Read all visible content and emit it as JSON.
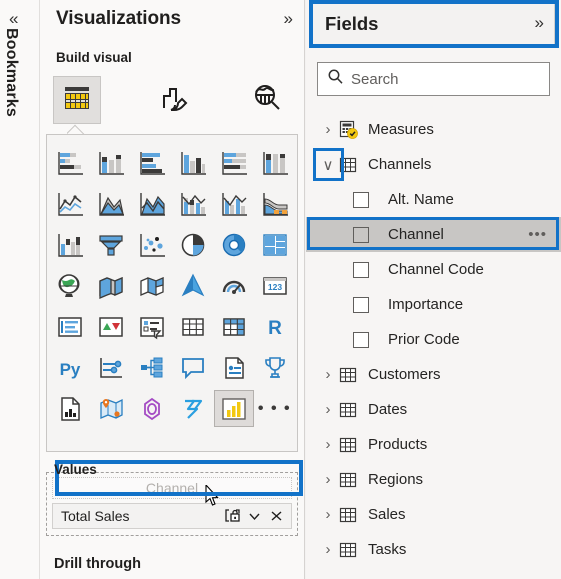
{
  "bookmarks_rail": {
    "label": "Bookmarks",
    "collapse_icon": "chevron-double-left-icon",
    "collapse_glyph": "«"
  },
  "visualizations": {
    "title": "Visualizations",
    "expand_icon": "chevron-double-right-icon",
    "expand_glyph": "»",
    "build_visual_label": "Build visual",
    "tabs": [
      {
        "name": "build",
        "icon": "table-visual-icon",
        "selected": true
      },
      {
        "name": "format",
        "icon": "paintbrush-format-icon",
        "selected": false
      },
      {
        "name": "analytics",
        "icon": "magnifier-analytics-icon",
        "selected": false
      }
    ],
    "gallery": [
      {
        "icon": "stacked-bar-chart-icon",
        "selected": false
      },
      {
        "icon": "stacked-column-chart-icon",
        "selected": false
      },
      {
        "icon": "clustered-bar-chart-icon",
        "selected": false
      },
      {
        "icon": "clustered-column-chart-icon",
        "selected": false
      },
      {
        "icon": "hundred-percent-stacked-bar-chart-icon",
        "selected": false
      },
      {
        "icon": "hundred-percent-stacked-column-chart-icon",
        "selected": false
      },
      {
        "icon": "line-chart-icon",
        "selected": false
      },
      {
        "icon": "area-chart-icon",
        "selected": false
      },
      {
        "icon": "stacked-area-chart-icon",
        "selected": false
      },
      {
        "icon": "line-stacked-column-chart-icon",
        "selected": false
      },
      {
        "icon": "line-clustered-column-chart-icon",
        "selected": false
      },
      {
        "icon": "ribbon-chart-icon",
        "selected": false
      },
      {
        "icon": "waterfall-chart-icon",
        "selected": false
      },
      {
        "icon": "funnel-chart-icon",
        "selected": false
      },
      {
        "icon": "scatter-chart-icon",
        "selected": false
      },
      {
        "icon": "pie-chart-icon",
        "selected": false
      },
      {
        "icon": "donut-chart-icon",
        "selected": false
      },
      {
        "icon": "treemap-icon",
        "selected": false
      },
      {
        "icon": "map-icon",
        "selected": false
      },
      {
        "icon": "filled-map-icon",
        "selected": false
      },
      {
        "icon": "shape-map-icon",
        "selected": false
      },
      {
        "icon": "arcgis-map-icon",
        "selected": false
      },
      {
        "icon": "gauge-icon",
        "selected": false
      },
      {
        "icon": "card-icon",
        "selected": false
      },
      {
        "icon": "multi-row-card-icon",
        "selected": false
      },
      {
        "icon": "kpi-icon",
        "selected": false
      },
      {
        "icon": "slicer-icon",
        "selected": false
      },
      {
        "icon": "table-icon",
        "selected": false
      },
      {
        "icon": "matrix-icon",
        "selected": false
      },
      {
        "icon": "r-script-visual-icon",
        "selected": false
      },
      {
        "icon": "python-visual-icon",
        "selected": false
      },
      {
        "icon": "key-influencers-icon",
        "selected": false
      },
      {
        "icon": "decomposition-tree-icon",
        "selected": false
      },
      {
        "icon": "qna-icon",
        "selected": false
      },
      {
        "icon": "smart-narrative-icon",
        "selected": false
      },
      {
        "icon": "metrics-trophy-icon",
        "selected": false
      },
      {
        "icon": "paginated-report-icon",
        "selected": false
      },
      {
        "icon": "azure-map-icon",
        "selected": false
      },
      {
        "icon": "power-apps-icon",
        "selected": false
      },
      {
        "icon": "power-automate-icon",
        "selected": false
      },
      {
        "icon": "selected-custom-visual-icon",
        "selected": true
      },
      {
        "icon": "more-options-icon",
        "selected": false,
        "glyph": "• • •"
      }
    ],
    "wells": {
      "values_label": "Values",
      "drag_ghost_text": "Channel",
      "chips": [
        {
          "name": "Total Sales",
          "buttons": [
            {
              "icon": "drill-lock-icon"
            },
            {
              "icon": "chevron-down-icon",
              "glyph": "∨"
            },
            {
              "icon": "remove-field-icon",
              "glyph": "✕"
            }
          ]
        }
      ],
      "drill_through_label": "Drill through"
    }
  },
  "fields": {
    "title": "Fields",
    "expand_icon": "chevron-double-right-icon",
    "expand_glyph": "»",
    "search": {
      "icon": "search-icon",
      "placeholder": "Search",
      "value": "Search"
    },
    "tree": [
      {
        "name": "Measures",
        "icon": "calculation-group-table-icon",
        "expanded": false,
        "chevron": "›",
        "fields": []
      },
      {
        "name": "Channels",
        "icon": "table-grid-icon",
        "expanded": true,
        "chevron": "∨",
        "fields": [
          {
            "name": "Alt. Name",
            "checked": false,
            "highlighted": false
          },
          {
            "name": "Channel",
            "checked": false,
            "highlighted": true,
            "ellipsis": "•••"
          },
          {
            "name": "Channel Code",
            "checked": false,
            "highlighted": false
          },
          {
            "name": "Importance",
            "checked": false,
            "highlighted": false
          },
          {
            "name": "Prior Code",
            "checked": false,
            "highlighted": false
          }
        ]
      },
      {
        "name": "Customers",
        "icon": "table-grid-icon",
        "expanded": false,
        "chevron": "›",
        "fields": []
      },
      {
        "name": "Dates",
        "icon": "table-grid-icon",
        "expanded": false,
        "chevron": "›",
        "fields": []
      },
      {
        "name": "Products",
        "icon": "table-grid-icon",
        "expanded": false,
        "chevron": "›",
        "fields": []
      },
      {
        "name": "Regions",
        "icon": "table-grid-icon",
        "expanded": false,
        "chevron": "›",
        "fields": []
      },
      {
        "name": "Sales",
        "icon": "table-grid-icon",
        "expanded": false,
        "chevron": "›",
        "fields": []
      },
      {
        "name": "Tasks",
        "icon": "table-grid-icon",
        "expanded": false,
        "chevron": "›",
        "fields": []
      }
    ]
  },
  "annotations": {
    "accent_color": "#1272c8",
    "boxes": [
      {
        "name": "fields-header-highlight"
      },
      {
        "name": "channels-chevron-highlight"
      },
      {
        "name": "channel-field-highlight"
      },
      {
        "name": "values-well-highlight"
      }
    ]
  }
}
